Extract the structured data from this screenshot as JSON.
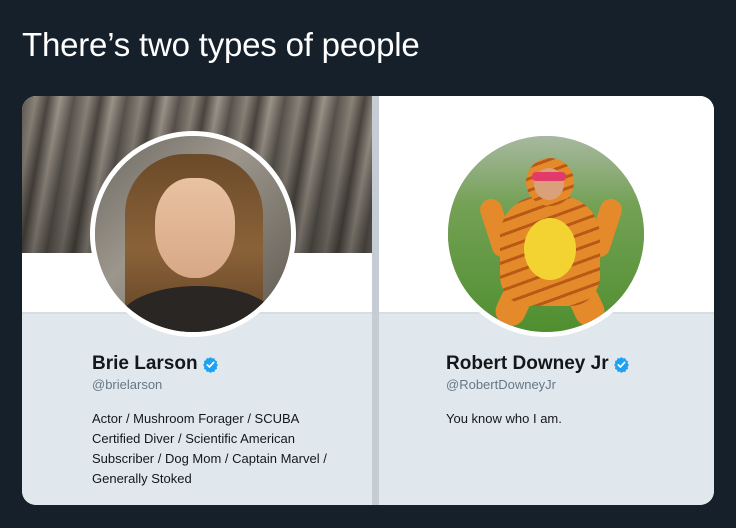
{
  "meme": {
    "title": "There’s two types of people"
  },
  "profiles": [
    {
      "name": "Brie Larson",
      "handle": "@brielarson",
      "verified": true,
      "bio_lines": [
        "Actor / Mushroom Forager / SCUBA",
        "Certified Diver / Scientific American",
        "Subscriber / Dog Mom / Captain Marvel /",
        "Generally Stoked"
      ],
      "banner": "stone-sculpture-photo",
      "avatar": "woman-portrait-photo"
    },
    {
      "name": "Robert Downey Jr",
      "handle": "@RobertDowneyJr",
      "verified": true,
      "bio_lines": [
        "You know who I am."
      ],
      "banner": "blank-white",
      "avatar": "man-in-tiger-costume-photo"
    }
  ],
  "colors": {
    "background": "#15202b",
    "card_info": "#e1e8ed",
    "verified_badge": "#1da1f2",
    "name_text": "#14171a",
    "handle_text": "#657786"
  }
}
